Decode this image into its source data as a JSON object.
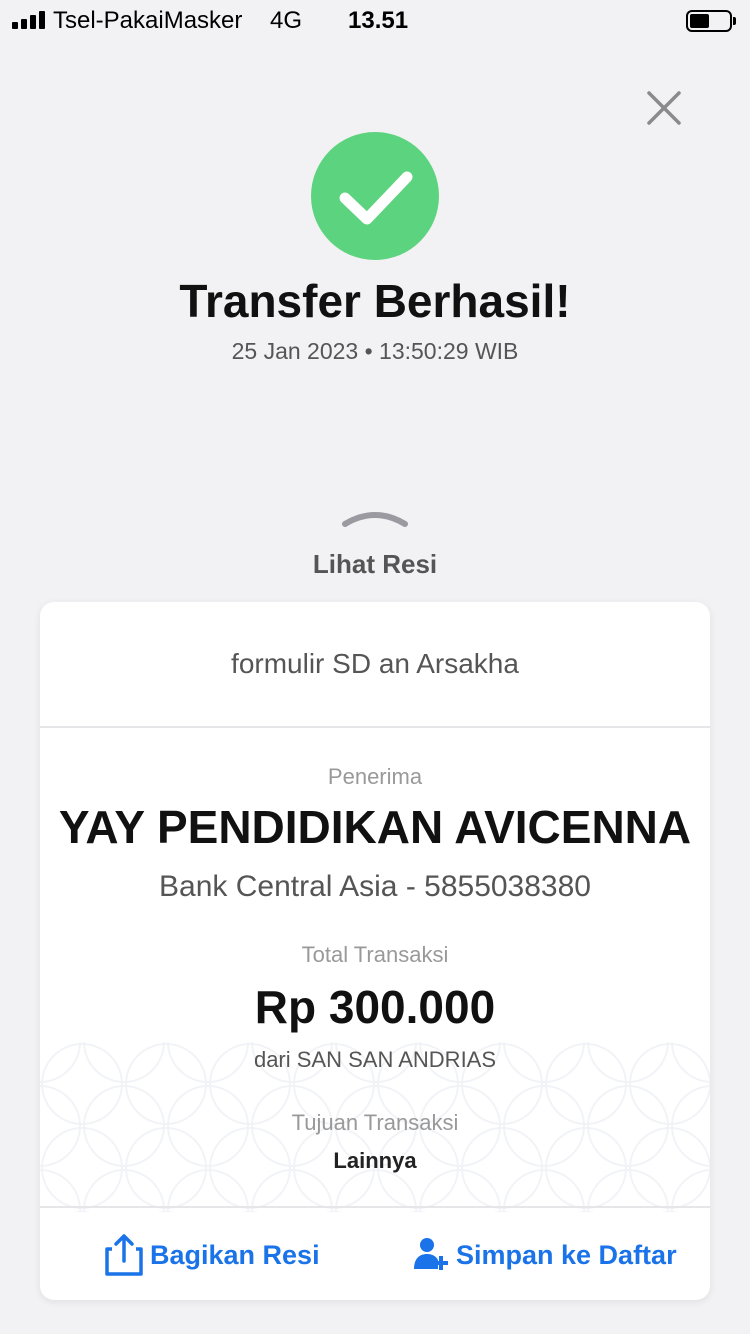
{
  "status_bar": {
    "carrier": "Tsel-PakaiMasker",
    "network": "4G",
    "time": "13.51",
    "battery_level": 0.5
  },
  "header": {
    "title": "Transfer Berhasil!",
    "datetime": "25 Jan 2023 • 13:50:29 WIB",
    "view_receipt_label": "Lihat Resi"
  },
  "receipt": {
    "note": "formulir SD an Arsakha",
    "recipient_label": "Penerima",
    "recipient_name": "YAY PENDIDIKAN AVICENNA",
    "recipient_bank": "Bank Central Asia - 5855038380",
    "total_label": "Total Transaksi",
    "amount": "Rp 300.000",
    "sender": "dari SAN SAN ANDRIAS",
    "purpose_label": "Tujuan Transaksi",
    "purpose": "Lainnya"
  },
  "actions": {
    "share_label": "Bagikan Resi",
    "save_label": "Simpan ke Daftar"
  },
  "colors": {
    "success": "#5cd37e",
    "accent": "#1a73e8",
    "background": "#f2f2f4"
  },
  "icons": {
    "close": "close-icon",
    "success": "check-circle-icon",
    "chevron": "chevron-up-icon",
    "share": "share-icon",
    "add_contact": "add-contact-icon"
  }
}
